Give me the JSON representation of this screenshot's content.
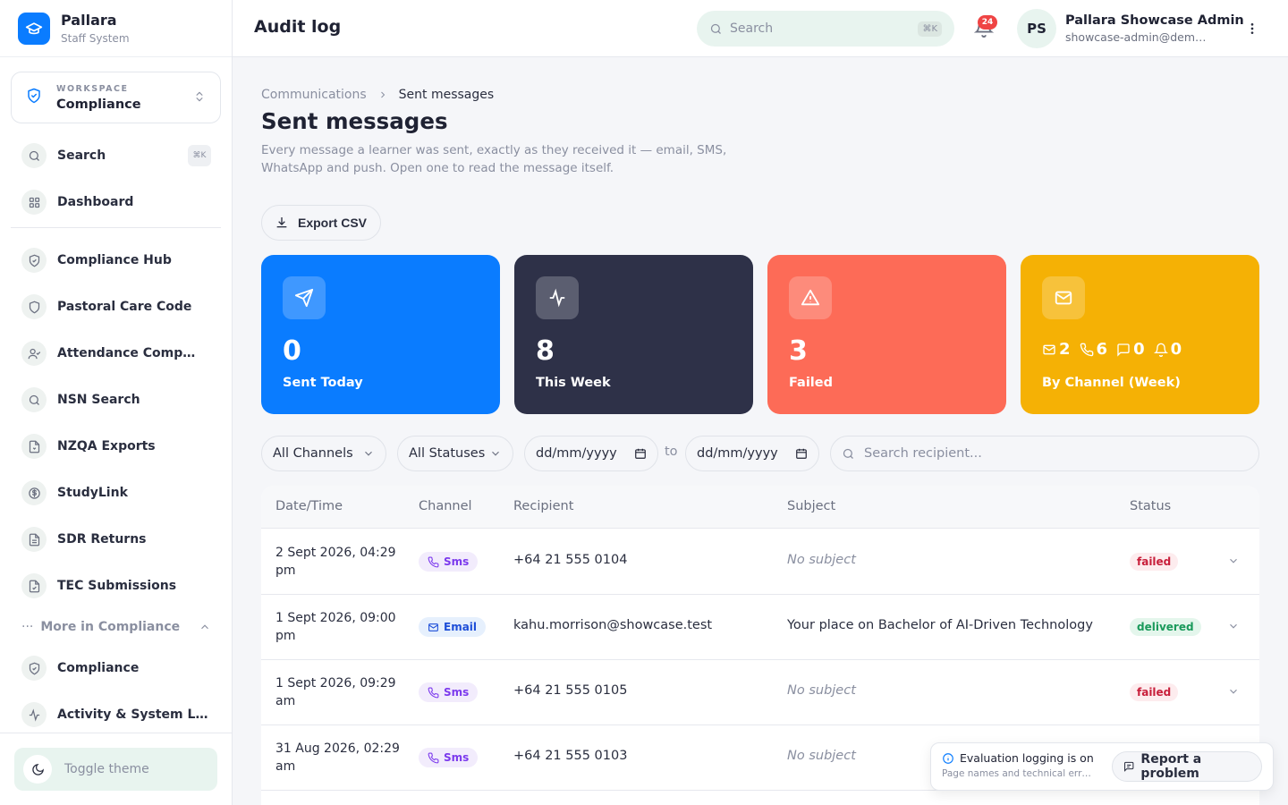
{
  "brand": {
    "name": "Pallara",
    "subtitle": "Staff System"
  },
  "workspace": {
    "label": "WORKSPACE",
    "value": "Compliance"
  },
  "sidebar": {
    "search_label": "Search",
    "search_shortcut": "⌘K",
    "items": [
      {
        "label": "Dashboard",
        "icon": "grid-icon"
      },
      {
        "label": "Compliance Hub",
        "icon": "shield-icon"
      },
      {
        "label": "Pastoral Care Code",
        "icon": "shield-icon"
      },
      {
        "label": "Attendance Comp…",
        "icon": "user-check-icon"
      },
      {
        "label": "NSN Search",
        "icon": "search-icon"
      },
      {
        "label": "NZQA Exports",
        "icon": "file-export-icon"
      },
      {
        "label": "StudyLink",
        "icon": "dollar-icon"
      },
      {
        "label": "SDR Returns",
        "icon": "file-text-icon"
      },
      {
        "label": "TEC Submissions",
        "icon": "file-check-icon"
      },
      {
        "label": "Compliance",
        "icon": "shield-check-icon"
      },
      {
        "label": "Activity & System L…",
        "icon": "activity-icon"
      }
    ],
    "more_label": "More in Compliance",
    "toggle_theme": "Toggle theme"
  },
  "topbar": {
    "title": "Audit log",
    "search_placeholder": "Search",
    "search_shortcut": "⌘K",
    "notification_count": "24",
    "avatar_initials": "PS",
    "user_name": "Pallara Showcase Admin",
    "user_email": "showcase-admin@dem…"
  },
  "breadcrumb": {
    "parent": "Communications",
    "current": "Sent messages"
  },
  "page": {
    "title": "Sent messages",
    "description": "Every message a learner was sent, exactly as they received it — email, SMS, WhatsApp and push. Open one to read the message itself.",
    "export_label": "Export CSV"
  },
  "stats": [
    {
      "value": "0",
      "label": "Sent Today",
      "color": "#0a7cff",
      "icon": "send-icon"
    },
    {
      "value": "8",
      "label": "This Week",
      "color": "#2e3148",
      "icon": "activity-icon"
    },
    {
      "value": "3",
      "label": "Failed",
      "color": "#fd6b57",
      "icon": "alert-triangle-icon"
    },
    {
      "label": "By Channel (Week)",
      "color": "#f5b105",
      "icon": "mail-icon",
      "channels": {
        "email": "2",
        "sms": "6",
        "whatsapp": "0",
        "push": "0"
      }
    }
  ],
  "filters": {
    "channel": "All Channels",
    "status": "All Statuses",
    "date_from_placeholder": "dd/mm/yyyy",
    "date_to_placeholder": "dd/mm/yyyy",
    "to_label": "to",
    "recipient_placeholder": "Search recipient..."
  },
  "table": {
    "headers": [
      "Date/Time",
      "Channel",
      "Recipient",
      "Subject",
      "Status"
    ],
    "rows": [
      {
        "date": "2 Sept 2026, 04:29 pm",
        "channel": "Sms",
        "recipient": "+64 21 555 0104",
        "subject": "No subject",
        "status": "failed"
      },
      {
        "date": "1 Sept 2026, 09:00 pm",
        "channel": "Email",
        "recipient": "kahu.morrison@showcase.test",
        "subject": "Your place on Bachelor of AI-Driven Technology",
        "status": "delivered"
      },
      {
        "date": "1 Sept 2026, 09:29 am",
        "channel": "Sms",
        "recipient": "+64 21 555 0105",
        "subject": "No subject",
        "status": "failed"
      },
      {
        "date": "31 Aug 2026, 02:29 am",
        "channel": "Sms",
        "recipient": "+64 21 555 0103",
        "subject": "No subject",
        "status": ""
      }
    ]
  },
  "eval_banner": {
    "title": "Evaluation logging is on",
    "subtitle": "Page names and technical err…",
    "report_label": "Report a problem"
  }
}
